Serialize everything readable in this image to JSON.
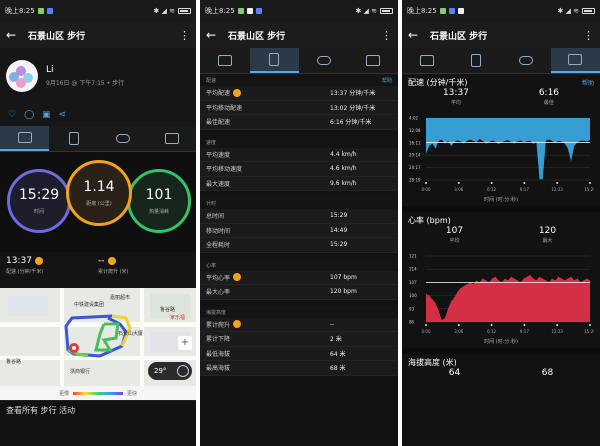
{
  "status": {
    "time": "晚上8:25",
    "icons": "⊙ ⊞ ⊡"
  },
  "activity": {
    "title": "石景山区 步行"
  },
  "p1": {
    "user": {
      "name": "Li",
      "meta": "9月16日 @ 下午7:15 • 步行"
    },
    "rings": [
      {
        "value": "15:29",
        "label": "时间",
        "color": "#6f6adf"
      },
      {
        "value": "1.14",
        "label": "距离 (公里)",
        "color": "#f2a21b"
      },
      {
        "value": "101",
        "label": "热量消耗",
        "color": "#33c36b"
      }
    ],
    "sub": [
      {
        "value": "13:37",
        "label": "配速 (分钟/千米)"
      },
      {
        "value": "--",
        "label": "累计爬升 (米)"
      }
    ],
    "map_labels": [
      "中铁建设集团",
      "嘉丽超市",
      "家乐福",
      "鲁谷路",
      "石景山大厦",
      "鲁谷路",
      "浙商银行"
    ],
    "map_controls": {
      "zoom_plus": "+",
      "temp": "29°"
    },
    "legend": {
      "left": "更慢",
      "right": "更快"
    },
    "view_all": "查看所有 步行 活动"
  },
  "p2": {
    "sections": [
      {
        "header": "配速",
        "help": "帮助",
        "rows": [
          {
            "k": "平均配速",
            "v": "13:37 分钟/千米",
            "icon": true
          },
          {
            "k": "平均移动配速",
            "v": "13:02 分钟/千米",
            "icon": false
          },
          {
            "k": "最佳配速",
            "v": "6:16 分钟/千米",
            "icon": false
          }
        ]
      },
      {
        "header": "速度",
        "help": "",
        "rows": [
          {
            "k": "平均速度",
            "v": "4.4 km/h",
            "icon": false
          },
          {
            "k": "平均移动速度",
            "v": "4.6 km/h",
            "icon": false
          },
          {
            "k": "最大速度",
            "v": "9.6 km/h",
            "icon": false
          }
        ]
      },
      {
        "header": "计时",
        "help": "",
        "rows": [
          {
            "k": "总时间",
            "v": "15:29",
            "icon": false
          },
          {
            "k": "移动时间",
            "v": "14:49",
            "icon": false
          },
          {
            "k": "全程耗时",
            "v": "15:29",
            "icon": false
          }
        ]
      },
      {
        "header": "心率",
        "help": "",
        "rows": [
          {
            "k": "平均心率",
            "v": "107 bpm",
            "icon": true
          },
          {
            "k": "最大心率",
            "v": "120 bpm",
            "icon": false
          }
        ]
      },
      {
        "header": "海拔高度",
        "help": "",
        "rows": [
          {
            "k": "累计爬升",
            "v": "--",
            "icon": true
          },
          {
            "k": "累计下降",
            "v": "2 米",
            "icon": false
          },
          {
            "k": "最低海拔",
            "v": "64 米",
            "icon": false
          },
          {
            "k": "最高海拔",
            "v": "68 米",
            "icon": false
          }
        ]
      }
    ]
  },
  "p3": {
    "pace": {
      "title": "配速 (分钟/千米)",
      "help": "帮助",
      "stats": [
        {
          "v": "13:37",
          "l": "平均"
        },
        {
          "v": "6:16",
          "l": "最佳"
        }
      ],
      "yticks": [
        "4:02",
        "12:08",
        "16:11",
        "20:14",
        "24:17",
        "28:19"
      ],
      "xticks": [
        "0:00",
        "3:06",
        "6:12",
        "9:17",
        "12:23",
        "15:29"
      ],
      "xlabel": "时间 (时:分:秒)"
    },
    "hr": {
      "title": "心率 (bpm)",
      "stats": [
        {
          "v": "107",
          "l": "平均"
        },
        {
          "v": "120",
          "l": "最大"
        }
      ],
      "yticks": [
        "121",
        "114",
        "107",
        "100",
        "93",
        "86"
      ],
      "xticks": [
        "0:00",
        "3:06",
        "6:12",
        "9:17",
        "12:23",
        "15:29"
      ],
      "xlabel": "时间 (时:分:秒)"
    },
    "alt": {
      "title": "海拔高度 (米)",
      "stats": [
        {
          "v": "64",
          "l": ""
        },
        {
          "v": "68",
          "l": ""
        }
      ]
    }
  },
  "chart_data": [
    {
      "type": "area",
      "title": "配速 (分钟/千米)",
      "xlabel": "时间 (时:分:秒)",
      "x_ticks": [
        "0:00",
        "3:06",
        "6:12",
        "9:17",
        "12:23",
        "15:29"
      ],
      "y_ticks": [
        "4:02",
        "12:08",
        "16:11",
        "20:14",
        "24:17",
        "28:19"
      ],
      "y_reversed": true,
      "ylim": [
        4.03,
        28.32
      ],
      "values": [
        18,
        15,
        14,
        16,
        13,
        12.5,
        14,
        13,
        15,
        13.5,
        12.8,
        13.2,
        14,
        13,
        12.5,
        13,
        13.5,
        12.2,
        13,
        14,
        13.6,
        12.8,
        13.3,
        14.2,
        13.6,
        13,
        12.7,
        13.4,
        14,
        13.2,
        12.8,
        13.6,
        13.1,
        12.9,
        14.1,
        13.4,
        28,
        28,
        13,
        12.4,
        13,
        13.8,
        12.9,
        13.3,
        14,
        16,
        21,
        15,
        13.6,
        13,
        12.9,
        13.3,
        12.6
      ],
      "color": "#3aa6de"
    },
    {
      "type": "area",
      "title": "心率 (bpm)",
      "xlabel": "时间 (时:分:秒)",
      "x_ticks": [
        "0:00",
        "3:06",
        "6:12",
        "9:17",
        "12:23",
        "15:29"
      ],
      "y_ticks": [
        "121",
        "114",
        "107",
        "100",
        "93",
        "86"
      ],
      "ylim": [
        86,
        121
      ],
      "values": [
        101,
        100,
        98,
        96,
        92,
        87,
        88,
        93,
        97,
        99,
        102,
        104,
        105,
        106,
        107,
        106,
        108,
        107,
        109,
        108,
        107,
        109,
        110,
        108,
        107,
        109,
        108,
        110,
        109,
        108,
        107,
        109,
        110,
        111,
        109,
        108,
        110,
        109,
        108,
        107,
        109,
        108,
        110,
        109,
        108,
        109,
        110,
        108,
        109,
        107,
        108,
        109,
        108
      ],
      "color": "#e0314a"
    }
  ]
}
